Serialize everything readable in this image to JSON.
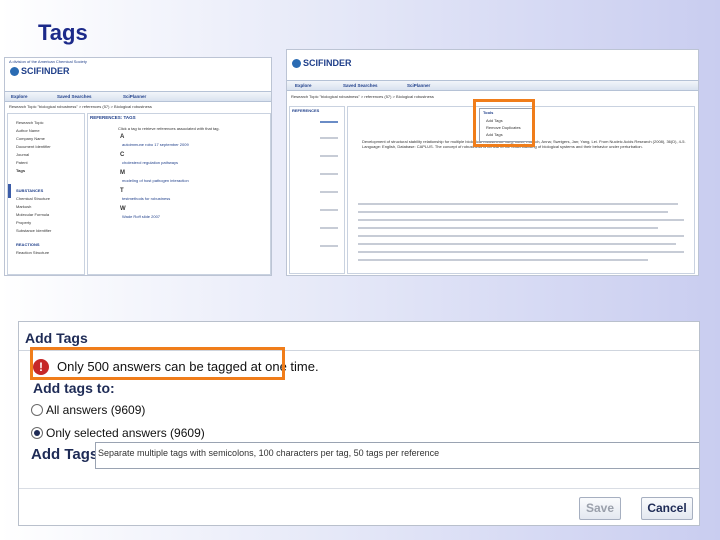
{
  "slide": {
    "title": "Tags"
  },
  "left_screenshot": {
    "logo": "SCIFINDER",
    "cas_label": "A division of the American Chemical Society",
    "nav": [
      "Explore",
      "Saved Searches",
      "SciPlanner"
    ],
    "breadcrumb": "Research Topic \"biological robustness\" > references (57) > Biological robustness",
    "analyze_header": "REFERENCES: TAGS",
    "panel_items": [
      "Research Topic",
      "Author Name",
      "Company Name",
      "Document Identifier",
      "Journal",
      "Patent",
      "Tags",
      "SUBSTANCES",
      "Chemical Structure",
      "Markush",
      "Molecular Formula",
      "Property",
      "Substance Identifier",
      "REACTIONS",
      "Reaction Structure"
    ],
    "tag_letters": [
      "A",
      "C",
      "M",
      "T",
      "W"
    ],
    "tag_entries": [
      "Click a tag to retrieve references associated with that tag.",
      "autoimmune robo 17 september 2009",
      "cholesterol regulation pathways",
      "modeling of host pathogen interaction",
      "testmethods for robustness",
      "Wade Roff slide 2007"
    ]
  },
  "right_screenshot": {
    "logo": "SCIFINDER",
    "nav": [
      "Explore",
      "Saved Searches",
      "SciPlanner"
    ],
    "breadcrumb": "Research Topic \"biological robustness\" > references (57) > Biological robustness",
    "tag_menu": {
      "header": "Tools",
      "items": [
        "Add Tags",
        "Remove Duplicates",
        "Add Tags"
      ]
    },
    "result_count": "REFERENCES",
    "ref_text": "Development of structural stability relationship for multiple biological robustness: Jurg, Ilona; Roesch, Anna; Sweigers, Jan; Yang, Lei. From Nucleic Acids Research (2008), 36(D), 4-5. Language: English, Database: CAPLUS. The concept of robustness is central to the understanding of biological systems and their behavior under perturbation."
  },
  "dialog": {
    "title": "Add Tags",
    "warning": "Only 500 answers can be tagged at one time.",
    "add_tags_to": "Add tags to:",
    "options": [
      {
        "label": "All answers (9609)",
        "selected": false
      },
      {
        "label": "Only selected answers (9609)",
        "selected": true
      }
    ],
    "tags_label": "Add Tags:",
    "tags_placeholder": "Separate multiple tags with semicolons, 100 characters per tag, 50 tags per reference",
    "save": "Save",
    "cancel": "Cancel"
  },
  "colors": {
    "highlight": "#f07d1a",
    "title": "#1c2a8a",
    "warning": "#c62828"
  }
}
